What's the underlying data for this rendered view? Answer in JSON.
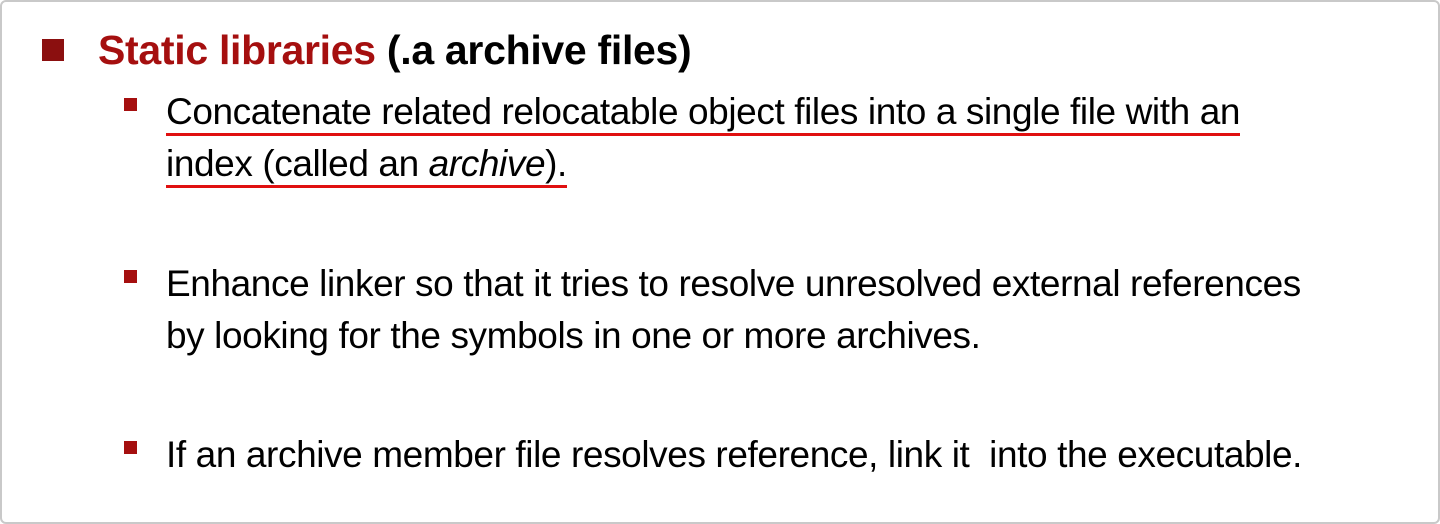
{
  "heading": {
    "accent": "Static libraries",
    "rest": " (.a archive files)"
  },
  "bullets": [
    {
      "line1": "Concatenate related relocatable object files into a single file with an",
      "line2_prefix": "index (called an ",
      "line2_emph": "archive",
      "line2_suffix": ")."
    },
    {
      "line1": "Enhance linker so that it tries to resolve unresolved external references",
      "line2": "by looking for the symbols in one or more archives."
    },
    {
      "line1": "If an archive member file resolves reference, link it  into the executable."
    }
  ],
  "colors": {
    "accent": "#a50f0f",
    "underline": "#e01010",
    "text": "#000000"
  }
}
